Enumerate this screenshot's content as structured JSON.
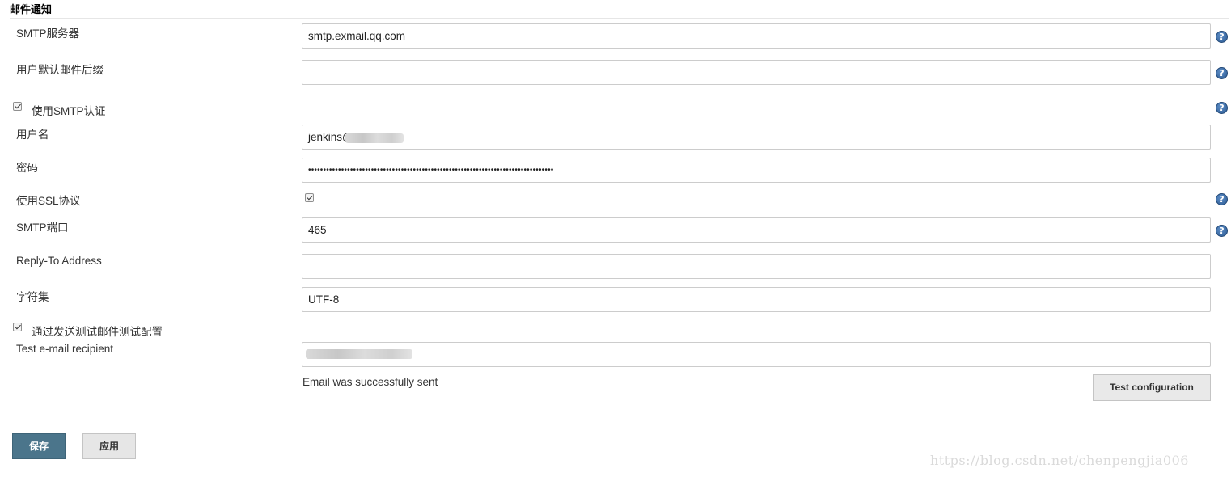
{
  "section": {
    "title": "邮件通知"
  },
  "fields": {
    "smtp_server": {
      "label": "SMTP服务器",
      "value": "smtp.exmail.qq.com"
    },
    "default_suffix": {
      "label": "用户默认邮件后缀",
      "value": ""
    },
    "use_smtp_auth": {
      "label": "使用SMTP认证",
      "checked": true
    },
    "username": {
      "label": "用户名",
      "value": "jenkins@"
    },
    "password": {
      "label": "密码",
      "value": "••••••••••••••••••••••••••••••••••••••••••••••••••••••••••••••••••••••••••••••••••"
    },
    "use_ssl": {
      "label": "使用SSL协议",
      "checked": true
    },
    "smtp_port": {
      "label": "SMTP端口",
      "value": "465"
    },
    "reply_to": {
      "label": "Reply-To Address",
      "value": ""
    },
    "charset": {
      "label": "字符集",
      "value": "UTF-8"
    },
    "test_by_email": {
      "label": "通过发送测试邮件测试配置",
      "checked": true
    },
    "test_recipient": {
      "label": "Test e-mail recipient",
      "value": ""
    }
  },
  "status_message": "Email was successfully sent",
  "buttons": {
    "test_configuration": "Test configuration",
    "save": "保存",
    "apply": "应用"
  },
  "help_icon": {
    "glyph": "?",
    "icon": "question-help-icon",
    "color": "#2d5c94"
  },
  "watermark": "https://blog.csdn.net/chenpengjia006",
  "colors": {
    "save_button": "#4b758b",
    "secondary_button": "#e6e6e6"
  }
}
